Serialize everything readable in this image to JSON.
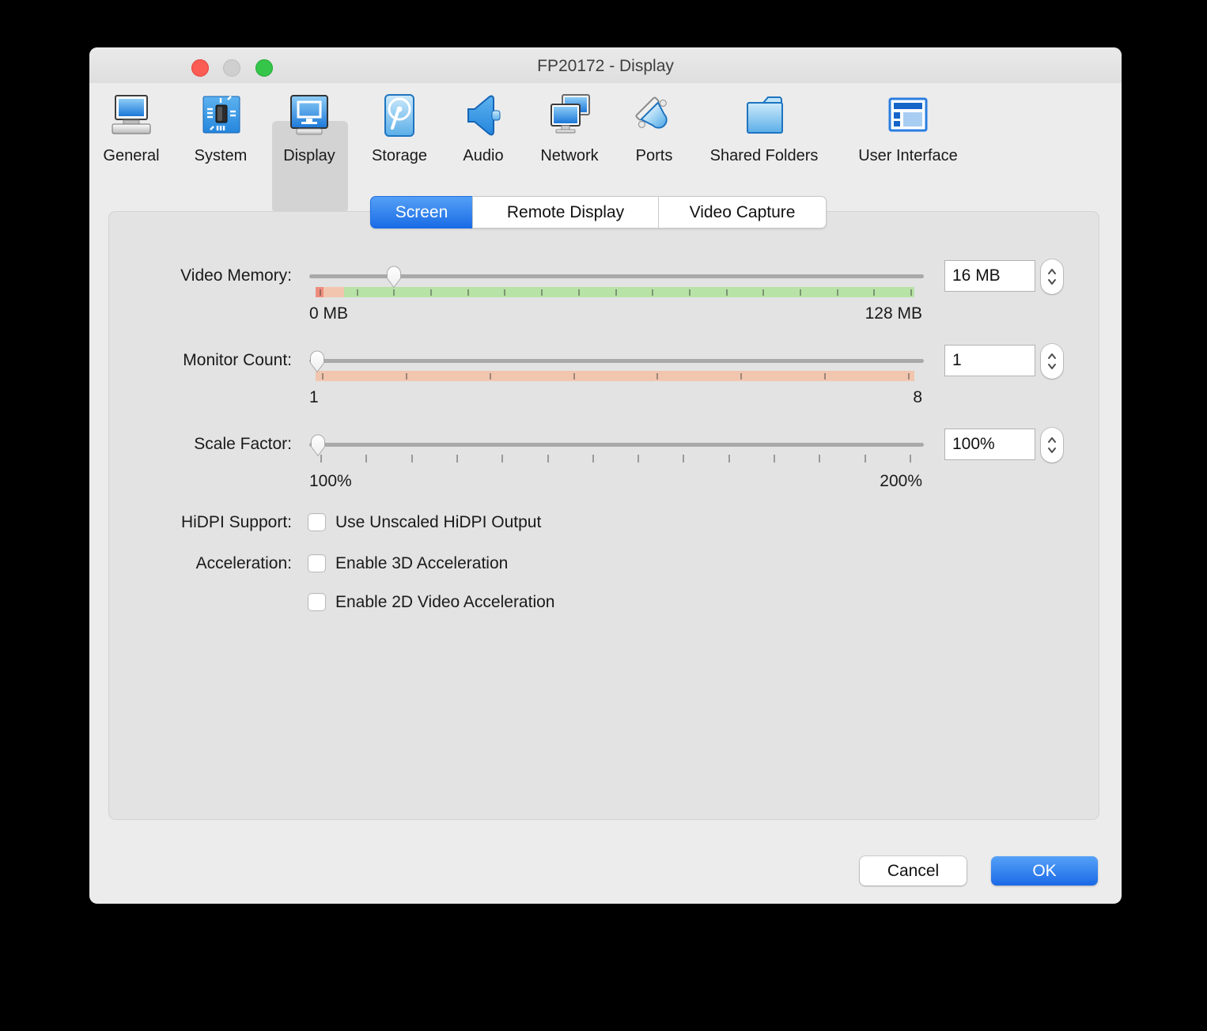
{
  "window": {
    "title": "FP20172 - Display"
  },
  "titlebar_buttons": {
    "close": "red",
    "minimize": "gray-disabled",
    "zoom": "green"
  },
  "toolbar": {
    "items": [
      {
        "label": "General",
        "icon": "general-monitor-icon",
        "selected": false
      },
      {
        "label": "System",
        "icon": "system-chip-icon",
        "selected": false
      },
      {
        "label": "Display",
        "icon": "display-monitor-icon",
        "selected": true
      },
      {
        "label": "Storage",
        "icon": "storage-disk-icon",
        "selected": false
      },
      {
        "label": "Audio",
        "icon": "audio-speaker-icon",
        "selected": false
      },
      {
        "label": "Network",
        "icon": "network-monitors-icon",
        "selected": false
      },
      {
        "label": "Ports",
        "icon": "ports-connector-icon",
        "selected": false
      },
      {
        "label": "Shared Folders",
        "icon": "shared-folder-icon",
        "selected": false
      },
      {
        "label": "User Interface",
        "icon": "user-interface-icon",
        "selected": false
      }
    ]
  },
  "tabs": [
    {
      "label": "Screen",
      "selected": true
    },
    {
      "label": "Remote Display",
      "selected": false
    },
    {
      "label": "Video Capture",
      "selected": false
    }
  ],
  "rows": {
    "video_memory": {
      "label": "Video Memory:",
      "value": "16 MB",
      "min_label": "0 MB",
      "max_label": "128 MB"
    },
    "monitor_count": {
      "label": "Monitor Count:",
      "value": "1",
      "min_label": "1",
      "max_label": "8"
    },
    "scale_factor": {
      "label": "Scale Factor:",
      "value": "100%",
      "min_label": "100%",
      "max_label": "200%"
    }
  },
  "checkboxes": {
    "hidpi": {
      "group_label": "HiDPI Support:",
      "label": "Use Unscaled HiDPI Output",
      "checked": false
    },
    "accel3d": {
      "group_label": "Acceleration:",
      "label": "Enable 3D Acceleration",
      "checked": false
    },
    "accel2d": {
      "group_label": "",
      "label": "Enable 2D Video Acceleration",
      "checked": false
    }
  },
  "buttons": {
    "cancel": "Cancel",
    "ok": "OK"
  },
  "colors": {
    "accent_blue": "#2a7de1",
    "bar_red": "#ee8d7e",
    "bar_orange": "#f2c5ae",
    "bar_green": "#b7e3a6",
    "selected_toolbar_bg": "#d3d3d3"
  }
}
